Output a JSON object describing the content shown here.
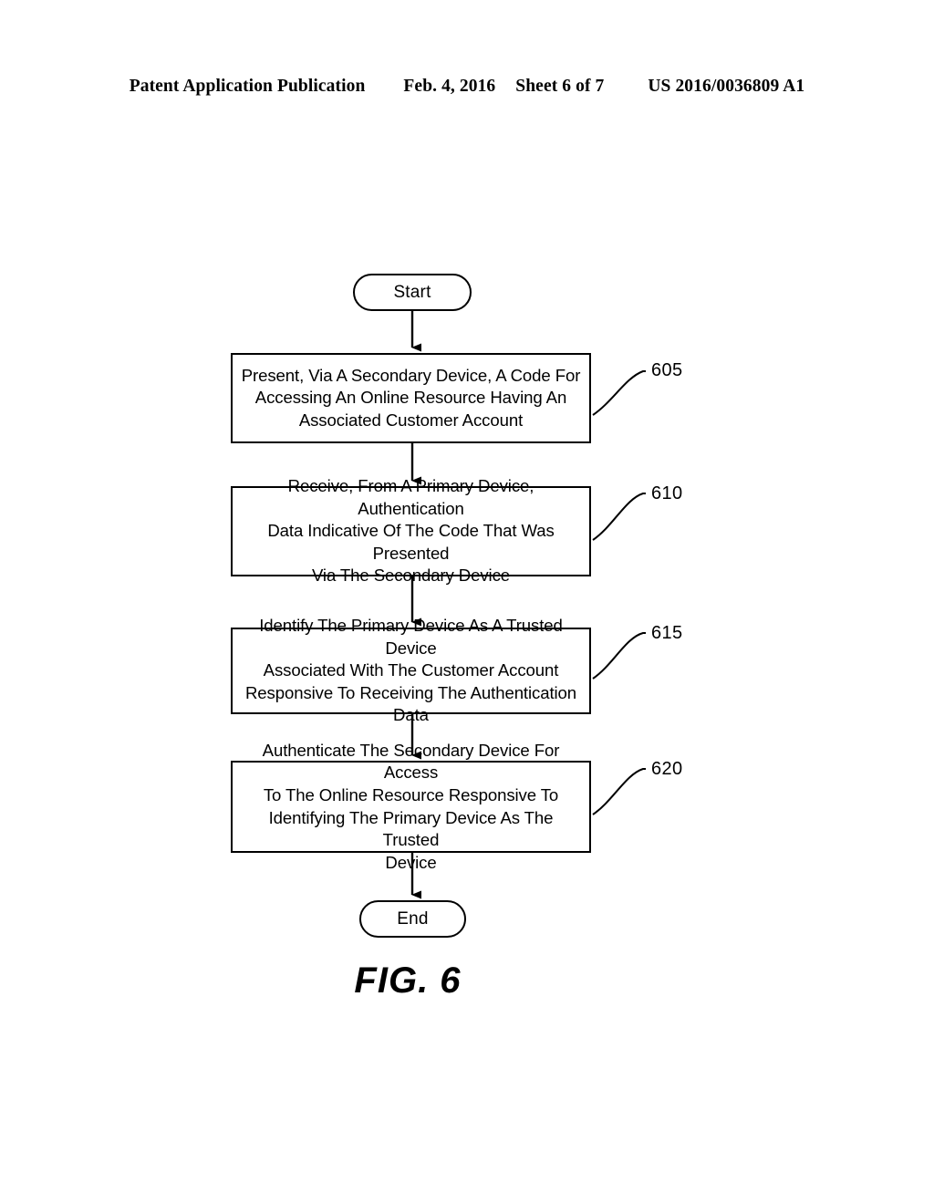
{
  "page": {
    "header": {
      "publication": "Patent Application Publication",
      "date": "Feb. 4, 2016",
      "sheet": "Sheet 6 of 7",
      "publication_number": "US 2016/0036809 A1"
    },
    "caption": "FIG. 6",
    "background_color": "#ffffff",
    "line_color": "#000000"
  },
  "flowchart": {
    "start_terminal": {
      "label": "Start"
    },
    "end_terminal": {
      "label": "End"
    },
    "steps": [
      {
        "ref": "605",
        "text": "Present, Via A Secondary Device, A Code For\nAccessing An Online Resource Having An\nAssociated Customer Account"
      },
      {
        "ref": "610",
        "text": "Receive, From A Primary Device, Authentication\nData Indicative Of The Code That Was Presented\nVia The Secondary Device"
      },
      {
        "ref": "615",
        "text": "Identify The Primary Device As A Trusted Device\nAssociated With The Customer Account\nResponsive To Receiving The Authentication Data"
      },
      {
        "ref": "620",
        "text": "Authenticate The Secondary Device For Access\nTo The Online Resource Responsive To\nIdentifying The Primary Device As The Trusted\nDevice"
      }
    ],
    "connectors": [
      {
        "name": "start-to-605",
        "from": "start_terminal",
        "to": "605",
        "style": "arrow-down"
      },
      {
        "name": "605-to-610",
        "from": "605",
        "to": "610",
        "style": "arrow-down"
      },
      {
        "name": "610-to-615",
        "from": "610",
        "to": "615",
        "style": "arrow-down"
      },
      {
        "name": "615-to-620",
        "from": "615",
        "to": "620",
        "style": "arrow-down"
      },
      {
        "name": "620-to-end",
        "from": "620",
        "to": "end_terminal",
        "style": "arrow-down"
      }
    ]
  }
}
